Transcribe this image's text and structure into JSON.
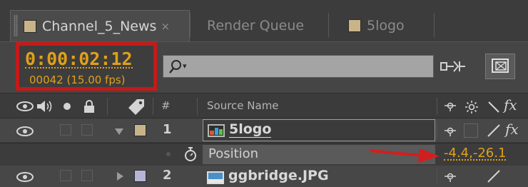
{
  "tabs": [
    {
      "label": "Channel_5_News",
      "swatch": "#c9b48a",
      "close": "×",
      "active": true
    },
    {
      "label": "Render Queue",
      "active": false
    },
    {
      "label": "5logo",
      "swatch": "#c9b48a",
      "active": false
    }
  ],
  "time": {
    "timecode": "0:00:02:12",
    "frame_info": "00042 (15.00 fps)",
    "highlight_color": "#c41a1a",
    "value_color": "#e0a01c"
  },
  "search": {
    "icon": "search-icon",
    "dropdown": "▾"
  },
  "columns": {
    "hash": "#",
    "source_name": "Source Name",
    "fx": "fx"
  },
  "layers": [
    {
      "number": "1",
      "name": "5logo",
      "label_color": "#c9b48a",
      "expanded": true,
      "icon": "composition-icon"
    },
    {
      "number": "2",
      "name": "ggbridge.JPG",
      "label_color": "#b7b4d9",
      "expanded": false,
      "icon": "image-footage-icon"
    }
  ],
  "property": {
    "name": "Position",
    "value": "-4.4,-26.1"
  },
  "row1_switch": "fx"
}
